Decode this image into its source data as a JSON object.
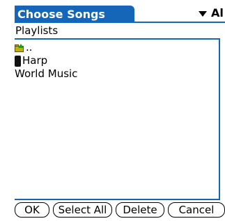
{
  "header": {
    "title": "Choose Songs",
    "category": "Al"
  },
  "section": {
    "label": "Playlists"
  },
  "list": {
    "items": [
      {
        "icon": "folder-up-icon",
        "label": ".."
      },
      {
        "icon": "cassette-icon",
        "label": "Harp"
      },
      {
        "icon": "",
        "label": "World Music"
      }
    ]
  },
  "buttons": {
    "ok": "OK",
    "select_all": "Select All",
    "delete": "Delete",
    "cancel": "Cancel"
  },
  "colors": {
    "accent": "#1566b8"
  }
}
